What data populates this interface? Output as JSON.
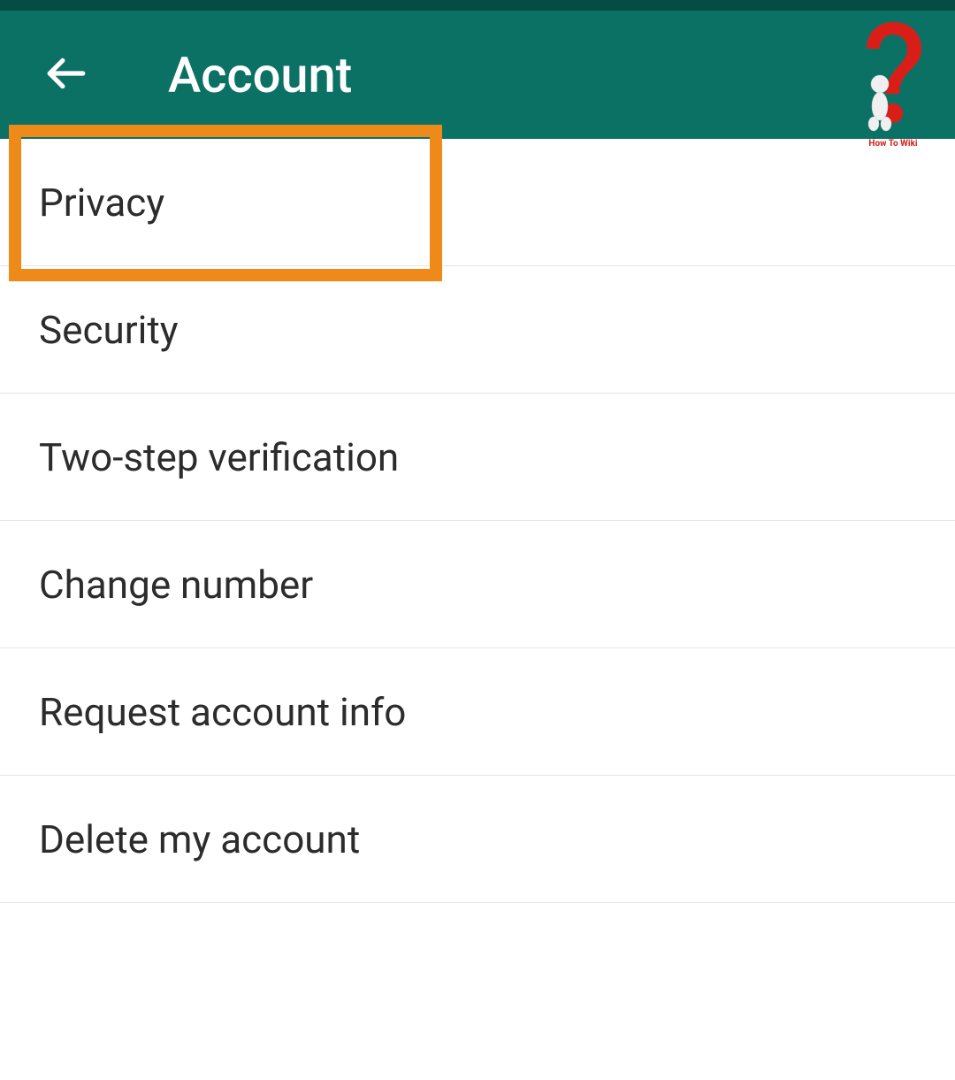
{
  "header": {
    "title": "Account"
  },
  "menu": {
    "items": [
      {
        "label": "Privacy"
      },
      {
        "label": "Security"
      },
      {
        "label": "Two-step verification"
      },
      {
        "label": "Change number"
      },
      {
        "label": "Request account info"
      },
      {
        "label": "Delete my account"
      }
    ]
  },
  "overlay": {
    "watermark_text": "How To Wiki"
  }
}
